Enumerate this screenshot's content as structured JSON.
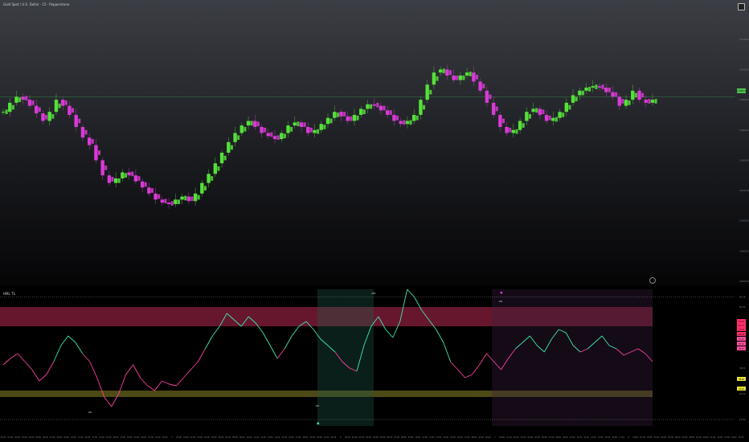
{
  "symbol_title": "Gold Spot / U.S. Dollar · 15 · Pepperstone",
  "indicator_title": "HML TS",
  "current_price": "2,981.9",
  "colors": {
    "up": "#55e03a",
    "down": "#d93ad6",
    "osc_high": "#3ee8b0",
    "osc_low": "#ff3fa3",
    "band_red": "#8a1f3c",
    "band_yellow": "#6e6a1e",
    "price_line": "#2e6e40"
  },
  "chart_data": [
    {
      "type": "line",
      "title": "Gold Spot / U.S. Dollar · 15 · Pepperstone",
      "series": [
        {
          "values": [
            2972,
            2978,
            2982,
            2980,
            2976,
            2971,
            2966,
            2972,
            2980,
            2976,
            2970,
            2962,
            2955,
            2950,
            2940,
            2930,
            2925,
            2928,
            2932,
            2930,
            2926,
            2922,
            2918,
            2914,
            2912,
            2911,
            2914,
            2916,
            2913,
            2918,
            2925,
            2931,
            2938,
            2945,
            2952,
            2958,
            2963,
            2966,
            2962,
            2958,
            2956,
            2954,
            2958,
            2963,
            2965,
            2962,
            2958,
            2960,
            2964,
            2968,
            2972,
            2969,
            2966,
            2970,
            2974,
            2977,
            2976,
            2973,
            2970,
            2966,
            2964,
            2966,
            2970,
            2980,
            2990,
            2998,
            3000,
            2996,
            2993,
            2996,
            2998,
            2992,
            2986,
            2978,
            2970,
            2962,
            2958,
            2960,
            2966,
            2972,
            2974,
            2970,
            2966,
            2968,
            2972,
            2978,
            2983,
            2986,
            2988,
            2989,
            2988,
            2985,
            2982,
            2976,
            2980,
            2986,
            2980,
            2978,
            2980
          ]
        }
      ],
      "y_ticks": [
        "3,020.00",
        "3,000.00",
        "2,980.00",
        "2,960.00",
        "2,940.00",
        "2,920.00",
        "2,900.00",
        "2,880.00",
        "2,860.00"
      ],
      "price_line": 2981.9
    },
    {
      "type": "line",
      "title": "HML TS",
      "series": [
        {
          "values": [
            48,
            52,
            55,
            50,
            45,
            38,
            42,
            50,
            60,
            66,
            62,
            55,
            50,
            40,
            28,
            22,
            30,
            42,
            48,
            40,
            35,
            32,
            38,
            36,
            35,
            40,
            45,
            50,
            58,
            66,
            72,
            80,
            76,
            72,
            78,
            74,
            68,
            60,
            52,
            58,
            66,
            72,
            75,
            70,
            64,
            60,
            56,
            50,
            46,
            44,
            60,
            72,
            78,
            70,
            65,
            75,
            95,
            90,
            82,
            76,
            70,
            62,
            50,
            45,
            40,
            42,
            48,
            55,
            50,
            45,
            52,
            58,
            62,
            66,
            60,
            56,
            64,
            70,
            68,
            60,
            56,
            58,
            62,
            66,
            60,
            58,
            54,
            56,
            58,
            55,
            50
          ]
        }
      ],
      "levels": [
        90.26,
        84,
        46,
        30,
        14
      ],
      "labels": {
        "peak1": "OB1",
        "peak2": "OB1",
        "trough1": "LB1",
        "trough2": "LB1",
        "arrow_top": "LB1"
      },
      "right_badges": [
        "91.08",
        "81.73",
        "75.42",
        "63.48",
        "57.91",
        "51.04",
        "46.33",
        "38.99",
        "34.20"
      ],
      "y_ticks": [
        "90.26",
        "84.00",
        "46.00",
        "30.00",
        "14.00"
      ]
    }
  ],
  "x_ticks": [
    "00:00 UTC",
    "01:00 UTC",
    "02:00 UTC",
    "03:00 UTC",
    "04:00 UTC",
    "05:00 UTC",
    "06:00 UTC",
    "07:00 UTC",
    "08:00 UTC",
    "09:00 UTC",
    "10:00 UTC",
    "11:00 UTC",
    "12:00 UTC",
    "13:00 UTC",
    "14:00 UTC",
    "15:00 UTC",
    "16:00 UTC",
    "17:00 UTC",
    "18:00 UTC",
    "19:00 UTC",
    "20:00 UTC",
    "21:00 UTC",
    "22:00 UTC",
    "23:00 UTC",
    "5",
    "00:00 UTC",
    "01:00 UTC",
    "02:00 UTC",
    "03:00 UTC",
    "04:00 UTC",
    "05:00 UTC",
    "06:00 UTC",
    "07:00 UTC",
    "08:00 UTC",
    "09:00 UTC",
    "10:00 UTC",
    "11:00 UTC",
    "12:00 UTC",
    "13:00 UTC",
    "14:00 UTC",
    "15:00 UTC",
    "16:00 UTC",
    "17:00 UTC",
    "18:00 UTC",
    "19:00 UTC",
    "20:00 UTC",
    "21:00 UTC",
    "22:00 UTC",
    "6",
    "00:00 UTC",
    "01:00 UTC",
    "02:00 UTC",
    "03:00 UTC",
    "04:00 UTC",
    "05:00 UTC",
    "06:00 UTC",
    "07:00 UTC",
    "08:00 UTC",
    "09:00 UTC",
    "10:00 UTC",
    "11:00 UTC",
    "12:00 UTC",
    "13:00 UTC",
    "14:00 UTC",
    "15:00 UTC",
    "16:00 UTC",
    "17:00 UTC",
    "18:00 UTC",
    "19:00 UTC",
    "20:00 UTC",
    "7",
    "00:00 UTC",
    "01:00 UTC",
    "02:00 UTC",
    "03:00 UTC",
    "04:00 UTC",
    "05:00 UTC",
    "06:00 UTC",
    "07:00 UTC",
    "08:00 UTC",
    "09:00 UTC",
    "10:00 UTC",
    "11:00 UTC",
    "12:00 UTC",
    "13:00 UTC",
    "14:00 UTC",
    "15:00 UTC",
    "16:00 UTC",
    "17:00 UTC",
    "8",
    "00:00 UTC",
    "01:00 UTC",
    "02:00 UTC",
    "03:00 UTC",
    "04:00 UTC",
    "05:00 UTC",
    "06:00 UTC",
    "07:00 UTC",
    "08:00 UTC",
    "09:00 UTC",
    "10:00 UTC",
    "11:00 UTC",
    "12:00 UTC",
    "13:00 UTC",
    "14:00 UTC",
    "15:00 UTC"
  ]
}
